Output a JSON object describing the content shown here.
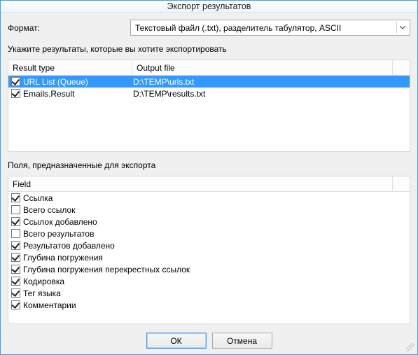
{
  "window": {
    "title": "Экспорт результатов"
  },
  "format": {
    "label": "Формат:",
    "selected": "Текстовый файл (.txt), разделитель табулятор, ASCII"
  },
  "section_results_label": "Укажите результаты, которые вы хотите экспортировать",
  "results_headers": {
    "type": "Result type",
    "file": "Output file"
  },
  "results": [
    {
      "checked": true,
      "selected": true,
      "type": "URL List (Queue)",
      "file": "D:\\TEMP\\urls.txt"
    },
    {
      "checked": true,
      "selected": false,
      "type": "Emails.Result",
      "file": "D:\\TEMP\\results.txt"
    }
  ],
  "section_fields_label": "Поля, предназначенные для экспорта",
  "fields_header": "Field",
  "fields": [
    {
      "checked": true,
      "label": "Ссылка"
    },
    {
      "checked": false,
      "label": "Всего ссылок"
    },
    {
      "checked": true,
      "label": "Ссылок добавлено"
    },
    {
      "checked": false,
      "label": "Всего результатов"
    },
    {
      "checked": true,
      "label": "Результатов добавлено"
    },
    {
      "checked": true,
      "label": "Глубина погружения"
    },
    {
      "checked": true,
      "label": "Глубина погружения перекрестных ссылок"
    },
    {
      "checked": true,
      "label": "Кодировка"
    },
    {
      "checked": true,
      "label": "Тег языка"
    },
    {
      "checked": true,
      "label": "Комментарии"
    }
  ],
  "buttons": {
    "ok": "ОК",
    "cancel": "Отмена"
  }
}
